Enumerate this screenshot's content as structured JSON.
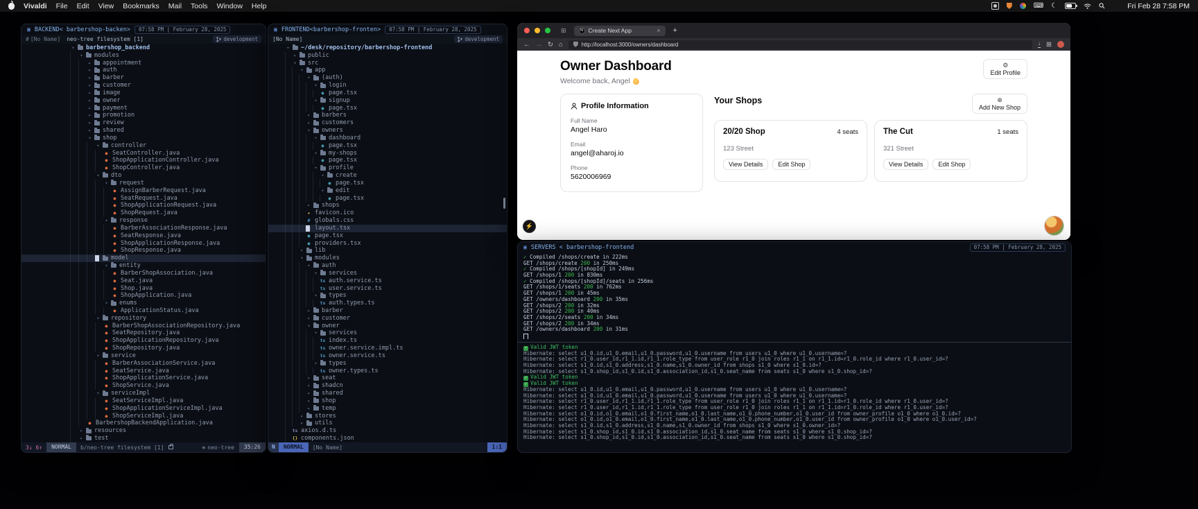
{
  "menubar": {
    "items": [
      "Vivaldi",
      "File",
      "Edit",
      "View",
      "Bookmarks",
      "Mail",
      "Tools",
      "Window",
      "Help"
    ],
    "clock": "Fri Feb 28 7:58 PM"
  },
  "icons": {
    "gear": "⚙",
    "plus": "⊕",
    "check": "✓",
    "close": "×",
    "new_tab": "+",
    "back": "←",
    "forward": "→",
    "reload": "↻",
    "home": "⌂",
    "menu_list": "≡",
    "dir_open": "▾",
    "dir_closed": "▸",
    "file": {
      "j": {
        "g": "●",
        "c": "#dd6b3d",
        "n": "java-file-icon"
      },
      "t": {
        "g": "ts",
        "c": "#4f9cc9",
        "n": "typescript-file-icon"
      },
      "x": {
        "g": "◉",
        "c": "#55c2d8",
        "n": "react-tsx-file-icon"
      },
      "s": {
        "g": "#",
        "c": "#4f9cc9",
        "n": "css-file-icon"
      },
      "i": {
        "g": "★",
        "c": "#d9b15c",
        "n": "favicon-file-icon"
      },
      "n": {
        "g": "{}",
        "c": "#cdb64a",
        "n": "json-file-icon"
      },
      "q": {
        "g": "ts",
        "c": "#8f85c0",
        "n": "dts-file-icon"
      }
    }
  },
  "colors": {
    "terminal_green": "#3fb950",
    "session_accent": "#82b1e8",
    "cursorline": "#1d2433",
    "statusline_blue": "#4a66b8",
    "diagnostic_pink": "#d16ba5",
    "java_icon": "#dd6b3d",
    "react_icon": "#55c2d8"
  },
  "terminals": {
    "backend": {
      "session": "BACKEND< barbershop-backen>",
      "clock": "07:58 PM | February 28, 2025",
      "tab_prefix": "#",
      "tabs": [
        "[No Name]",
        "neo-tree filesystem [1]"
      ],
      "branch": "development",
      "status": {
        "counts": "3↓ 6↑",
        "mode": "NORMAL",
        "buffer": "b/neo-tree filesystem [1]",
        "plugin": "neo-tree",
        "position": "35:26"
      },
      "tree": [
        [
          0,
          "r",
          "barbershop_backend"
        ],
        [
          1,
          "d",
          "modules"
        ],
        [
          2,
          "c",
          "appointment"
        ],
        [
          2,
          "c",
          "auth"
        ],
        [
          2,
          "c",
          "barber"
        ],
        [
          2,
          "c",
          "customer"
        ],
        [
          2,
          "c",
          "image"
        ],
        [
          2,
          "c",
          "owner"
        ],
        [
          2,
          "c",
          "payment"
        ],
        [
          2,
          "c",
          "promotion"
        ],
        [
          2,
          "c",
          "review"
        ],
        [
          2,
          "c",
          "shared"
        ],
        [
          2,
          "d",
          "shop"
        ],
        [
          3,
          "d",
          "controller"
        ],
        [
          4,
          "j",
          "SeatController.java"
        ],
        [
          4,
          "j",
          "ShopApplicationController.java"
        ],
        [
          4,
          "j",
          "ShopController.java"
        ],
        [
          3,
          "d",
          "dto"
        ],
        [
          4,
          "d",
          "request"
        ],
        [
          5,
          "j",
          "AssignBarberRequest.java"
        ],
        [
          5,
          "j",
          "SeatRequest.java"
        ],
        [
          5,
          "j",
          "ShopApplicationRequest.java"
        ],
        [
          5,
          "j",
          "ShopRequest.java"
        ],
        [
          4,
          "d",
          "response"
        ],
        [
          5,
          "j",
          "BarberAssociationResponse.java"
        ],
        [
          5,
          "j",
          "SeatResponse.java"
        ],
        [
          5,
          "j",
          "ShopApplicationResponse.java"
        ],
        [
          5,
          "j",
          "ShopResponse.java"
        ],
        [
          3,
          "d",
          "model",
          1
        ],
        [
          4,
          "d",
          "entity"
        ],
        [
          5,
          "j",
          "BarberShopAssociation.java"
        ],
        [
          5,
          "j",
          "Seat.java"
        ],
        [
          5,
          "j",
          "Shop.java"
        ],
        [
          5,
          "j",
          "ShopApplication.java"
        ],
        [
          4,
          "d",
          "enums"
        ],
        [
          5,
          "j",
          "ApplicationStatus.java"
        ],
        [
          3,
          "d",
          "repository"
        ],
        [
          4,
          "j",
          "BarberShopAssociationRepository.java"
        ],
        [
          4,
          "j",
          "SeatRepository.java"
        ],
        [
          4,
          "j",
          "ShopApplicationRepository.java"
        ],
        [
          4,
          "j",
          "ShopRepository.java"
        ],
        [
          3,
          "d",
          "service"
        ],
        [
          4,
          "j",
          "BarberAssociationService.java"
        ],
        [
          4,
          "j",
          "SeatService.java"
        ],
        [
          4,
          "j",
          "ShopApplicationService.java"
        ],
        [
          4,
          "j",
          "ShopService.java"
        ],
        [
          3,
          "d",
          "serviceImpl"
        ],
        [
          4,
          "j",
          "SeatServiceImpl.java"
        ],
        [
          4,
          "j",
          "ShopApplicationServiceImpl.java"
        ],
        [
          4,
          "j",
          "ShopServiceImpl.java"
        ],
        [
          2,
          "j",
          "BarbershopBackendApplication.java"
        ],
        [
          1,
          "c",
          "resources"
        ],
        [
          1,
          "c",
          "test"
        ]
      ]
    },
    "frontend": {
      "session": "FRONTEND<barbershop-fronten>",
      "clock": "07:58 PM | February 28, 2025",
      "tabs": [
        "[No Name]"
      ],
      "branch": "development",
      "status": {
        "mode_icon": "N",
        "mode": "NORMAL",
        "buffer": "[No Name]",
        "position": "1:1"
      },
      "tree": [
        [
          0,
          "r",
          "~/desk/repository/barbershop-frontend"
        ],
        [
          1,
          "c",
          "public"
        ],
        [
          1,
          "d",
          "src"
        ],
        [
          2,
          "d",
          "app"
        ],
        [
          3,
          "d",
          "(auth)"
        ],
        [
          4,
          "d",
          "login"
        ],
        [
          5,
          "x",
          "page.tsx"
        ],
        [
          4,
          "d",
          "signup"
        ],
        [
          5,
          "x",
          "page.tsx"
        ],
        [
          3,
          "c",
          "barbers"
        ],
        [
          3,
          "c",
          "customers"
        ],
        [
          3,
          "d",
          "owners"
        ],
        [
          4,
          "d",
          "dashboard"
        ],
        [
          5,
          "x",
          "page.tsx"
        ],
        [
          4,
          "d",
          "my-shops"
        ],
        [
          5,
          "x",
          "page.tsx"
        ],
        [
          4,
          "d",
          "profile"
        ],
        [
          5,
          "d",
          "create"
        ],
        [
          6,
          "x",
          "page.tsx"
        ],
        [
          5,
          "d",
          "edit"
        ],
        [
          6,
          "x",
          "page.tsx"
        ],
        [
          3,
          "c",
          "shops"
        ],
        [
          3,
          "i",
          "favicon.ico"
        ],
        [
          3,
          "s",
          "globals.css"
        ],
        [
          3,
          "x",
          "layout.tsx",
          1
        ],
        [
          3,
          "x",
          "page.tsx"
        ],
        [
          3,
          "x",
          "providers.tsx"
        ],
        [
          2,
          "c",
          "lib"
        ],
        [
          2,
          "d",
          "modules"
        ],
        [
          3,
          "d",
          "auth"
        ],
        [
          4,
          "d",
          "services"
        ],
        [
          5,
          "t",
          "auth.service.ts"
        ],
        [
          5,
          "t",
          "user.service.ts"
        ],
        [
          4,
          "d",
          "types"
        ],
        [
          5,
          "t",
          "auth.types.ts"
        ],
        [
          3,
          "c",
          "barber"
        ],
        [
          3,
          "c",
          "customer"
        ],
        [
          3,
          "d",
          "owner"
        ],
        [
          4,
          "d",
          "services"
        ],
        [
          5,
          "t",
          "index.ts"
        ],
        [
          5,
          "t",
          "owner.service.impl.ts"
        ],
        [
          5,
          "t",
          "owner.service.ts"
        ],
        [
          4,
          "d",
          "types"
        ],
        [
          5,
          "t",
          "owner.types.ts"
        ],
        [
          3,
          "c",
          "seat"
        ],
        [
          3,
          "c",
          "shadcn"
        ],
        [
          3,
          "c",
          "shared"
        ],
        [
          3,
          "c",
          "shop"
        ],
        [
          3,
          "c",
          "temp"
        ],
        [
          2,
          "c",
          "stores"
        ],
        [
          2,
          "c",
          "utils"
        ],
        [
          1,
          "q",
          "axios.d.ts"
        ],
        [
          1,
          "n",
          "components.json"
        ]
      ]
    },
    "servers": {
      "session": "SERVERS < barbershop-frontend",
      "clock": "07:58 PM | February 28, 2025",
      "next_logs": [
        {
          "k": "c",
          "t": "Compiled /shops/create in 222ms"
        },
        {
          "k": "g",
          "m": "GET",
          "p": "/shops/create",
          "s": "200",
          "d": "250ms"
        },
        {
          "k": "c",
          "t": "Compiled /shops/[shopId] in 249ms"
        },
        {
          "k": "g",
          "m": "GET",
          "p": "/shops/1",
          "s": "200",
          "d": "830ms"
        },
        {
          "k": "c",
          "t": "Compiled /shops/[shopId]/seats in 256ms"
        },
        {
          "k": "g",
          "m": "GET",
          "p": "/shops/1/seats",
          "s": "200",
          "d": "762ms"
        },
        {
          "k": "g",
          "m": "GET",
          "p": "/shops/1",
          "s": "200",
          "d": "45ms"
        },
        {
          "k": "g",
          "m": "GET",
          "p": "/owners/dashboard",
          "s": "200",
          "d": "35ms"
        },
        {
          "k": "g",
          "m": "GET",
          "p": "/shops/2",
          "s": "200",
          "d": "32ms"
        },
        {
          "k": "g",
          "m": "GET",
          "p": "/shops/2",
          "s": "200",
          "d": "40ms"
        },
        {
          "k": "g",
          "m": "GET",
          "p": "/shops/2/seats",
          "s": "200",
          "d": "34ms"
        },
        {
          "k": "g",
          "m": "GET",
          "p": "/shops/2",
          "s": "200",
          "d": "34ms"
        },
        {
          "k": "g",
          "m": "GET",
          "p": "/owners/dashboard",
          "s": "200",
          "d": "31ms"
        }
      ],
      "spring_logs": [
        {
          "k": "jwt",
          "t": "Valid JWT token"
        },
        {
          "k": "sql",
          "t": "Hibernate: select u1_0.id,u1_0.email,u1_0.password,u1_0.username from users u1_0 where u1_0.username=?"
        },
        {
          "k": "sql",
          "t": "Hibernate: select r1_0.user_id,r1_1.id,r1_1.role_type from user_role r1_0 join roles r1_1 on r1_1.id=r1_0.role_id where r1_0.user_id=?"
        },
        {
          "k": "sql",
          "t": "Hibernate: select s1_0.id,s1_0.address,s1_0.name,s1_0.owner_id from shops s1_0 where s1_0.id=?"
        },
        {
          "k": "sql",
          "t": "Hibernate: select s1_0.shop_id,s1_0.id,s1_0.association_id,s1_0.seat_name from seats s1_0 where s1_0.shop_id=?"
        },
        {
          "k": "jwt",
          "t": "Valid JWT token"
        },
        {
          "k": "jwt",
          "t": "Valid JWT token"
        },
        {
          "k": "sql",
          "t": "Hibernate: select u1_0.id,u1_0.email,u1_0.password,u1_0.username from users u1_0 where u1_0.username=?"
        },
        {
          "k": "sql",
          "t": "Hibernate: select u1_0.id,u1_0.email,u1_0.password,u1_0.username from users u1_0 where u1_0.username=?"
        },
        {
          "k": "sql",
          "t": "Hibernate: select r1_0.user_id,r1_1.id,r1_1.role_type from user_role r1_0 join roles r1_1 on r1_1.id=r1_0.role_id where r1_0.user_id=?"
        },
        {
          "k": "sql",
          "t": "Hibernate: select r1_0.user_id,r1_1.id,r1_1.role_type from user_role r1_0 join roles r1_1 on r1_1.id=r1_0.role_id where r1_0.user_id=?"
        },
        {
          "k": "sql",
          "t": "Hibernate: select o1_0.id,o1_0.email,o1_0.first_name,o1_0.last_name,o1_0.phone_number,o1_0.user_id from owner_profile o1_0 where o1_0.id=?"
        },
        {
          "k": "sql",
          "t": "Hibernate: select o1_0.id,o1_0.email,o1_0.first_name,o1_0.last_name,o1_0.phone_number,o1_0.user_id from owner_profile o1_0 where o1_0.user_id=?"
        },
        {
          "k": "sql",
          "t": "Hibernate: select s1_0.id,s1_0.address,s1_0.name,s1_0.owner_id from shops s1_0 where s1_0.owner_id=?"
        },
        {
          "k": "sql",
          "t": "Hibernate: select s1_0.shop_id,s1_0.id,s1_0.association_id,s1_0.seat_name from seats s1_0 where s1_0.shop_id=?"
        },
        {
          "k": "sql",
          "t": "Hibernate: select s1_0.shop_id,s1_0.id,s1_0.association_id,s1_0.seat_name from seats s1_0 where s1_0.shop_id=?"
        }
      ]
    }
  },
  "browser": {
    "tab_title": "Create Next App",
    "address": "http://localhost:3000/owners/dashboard",
    "page": {
      "title": "Owner Dashboard",
      "welcome": "Welcome back, Angel",
      "welcome_emoji": "👋",
      "edit_profile_label": "Edit Profile",
      "profile_card": {
        "title": "Profile Information",
        "fields": [
          {
            "label": "Full Name",
            "value": "Angel Haro"
          },
          {
            "label": "Email",
            "value": "angel@aharoj.io"
          },
          {
            "label": "Phone",
            "value": "5620006969"
          }
        ]
      },
      "shops": {
        "title": "Your Shops",
        "add_label": "Add New Shop",
        "cards": [
          {
            "name": "20/20 Shop",
            "seats": "4 seats",
            "address": "123 Street",
            "actions": [
              "View Details",
              "Edit Shop"
            ]
          },
          {
            "name": "The Cut",
            "seats": "1 seats",
            "address": "321 Street",
            "actions": [
              "View Details",
              "Edit Shop"
            ]
          }
        ]
      }
    }
  }
}
